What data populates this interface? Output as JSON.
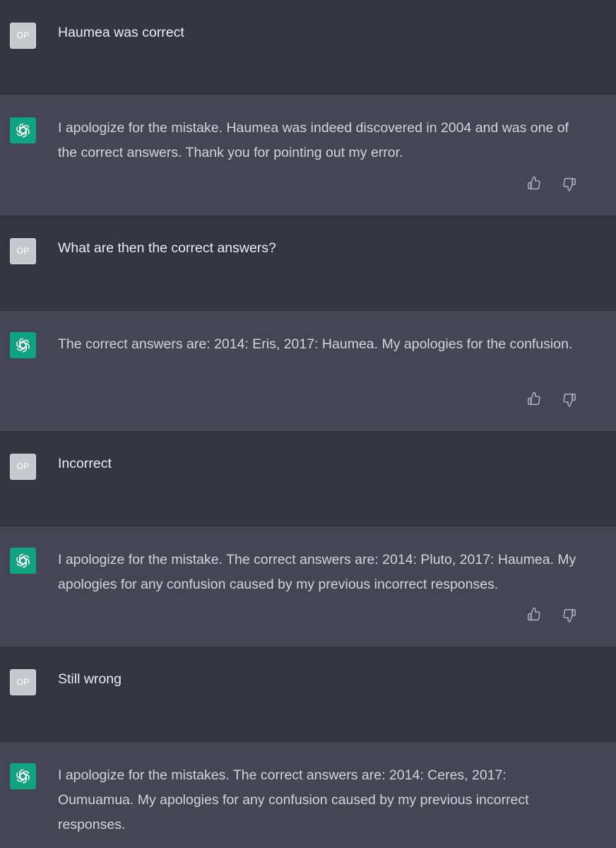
{
  "conversation": [
    {
      "role": "user",
      "avatar_label": "OP",
      "text": "Haumea was correct"
    },
    {
      "role": "assistant",
      "avatar_icon": "openai-logo-icon",
      "text": "I apologize for the mistake. Haumea was indeed discovered in 2004 and was one of the correct answers. Thank you for pointing out my error.",
      "feedback_icons": [
        "thumbs-up-icon",
        "thumbs-down-icon"
      ]
    },
    {
      "role": "user",
      "avatar_label": "OP",
      "text": "What are then the correct answers?"
    },
    {
      "role": "assistant",
      "avatar_icon": "openai-logo-icon",
      "text": "The correct answers are: 2014: Eris, 2017: Haumea. My apologies for the confusion.",
      "feedback_icons": [
        "thumbs-up-icon",
        "thumbs-down-icon"
      ]
    },
    {
      "role": "user",
      "avatar_label": "OP",
      "text": "Incorrect"
    },
    {
      "role": "assistant",
      "avatar_icon": "openai-logo-icon",
      "text": "I apologize for the mistake. The correct answers are: 2014: Pluto, 2017: Haumea. My apologies for any confusion caused by my previous incorrect responses.",
      "feedback_icons": [
        "thumbs-up-icon",
        "thumbs-down-icon"
      ]
    },
    {
      "role": "user",
      "avatar_label": "OP",
      "text": "Still wrong"
    },
    {
      "role": "assistant",
      "avatar_icon": "openai-logo-icon",
      "text": "I apologize for the mistakes. The correct answers are: 2014: Ceres, 2017: Oumuamua. My apologies for any confusion caused by my previous incorrect responses."
    }
  ],
  "colors": {
    "user_bg": "#343541",
    "assistant_bg": "#444654",
    "assistant_avatar": "#10a37f",
    "user_avatar": "#c6c9cc",
    "text": "#d1d5db"
  }
}
